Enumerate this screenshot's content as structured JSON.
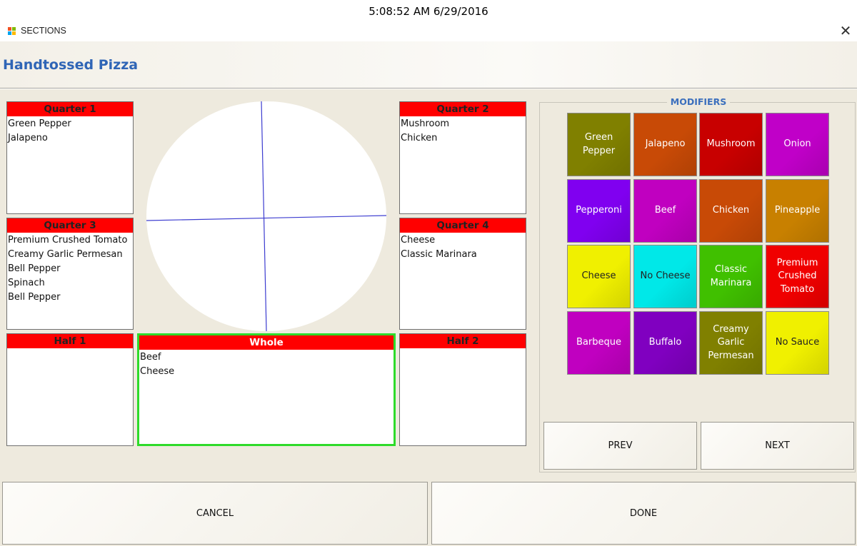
{
  "clock": "5:08:52 AM 6/29/2016",
  "window": {
    "title": "SECTIONS",
    "close_glyph": "✕"
  },
  "header": {
    "title": "Handtossed Pizza"
  },
  "sections": {
    "quarter1": {
      "title": "Quarter 1",
      "items": [
        "Green Pepper",
        "Jalapeno"
      ]
    },
    "quarter2": {
      "title": "Quarter 2",
      "items": [
        "Mushroom",
        "Chicken"
      ]
    },
    "quarter3": {
      "title": "Quarter 3",
      "items": [
        "Premium Crushed Tomato",
        "Creamy Garlic Permesan",
        "Bell Pepper",
        "Spinach",
        "Bell Pepper"
      ]
    },
    "quarter4": {
      "title": "Quarter 4",
      "items": [
        "Cheese",
        "Classic Marinara"
      ]
    },
    "half1": {
      "title": "Half 1",
      "items": []
    },
    "whole": {
      "title": "Whole",
      "items": [
        "Beef",
        "Cheese"
      ]
    },
    "half2": {
      "title": "Half 2",
      "items": []
    }
  },
  "modifiers": {
    "title": "MODIFIERS",
    "items": [
      {
        "label": "Green Pepper",
        "color": "#808000"
      },
      {
        "label": "Jalapeno",
        "color": "#c84a06"
      },
      {
        "label": "Mushroom",
        "color": "#c80000"
      },
      {
        "label": "Onion",
        "color": "#c000c8"
      },
      {
        "label": "Pepperoni",
        "color": "#8000f0"
      },
      {
        "label": "Beef",
        "color": "#c000c0"
      },
      {
        "label": "Chicken",
        "color": "#c84a06"
      },
      {
        "label": "Pineapple",
        "color": "#c88000"
      },
      {
        "label": "Cheese",
        "color": "#f0f000"
      },
      {
        "label": "No Cheese",
        "color": "#00e8e8"
      },
      {
        "label": "Classic Marinara",
        "color": "#40c000"
      },
      {
        "label": "Premium Crushed Tomato",
        "color": "#f00000"
      },
      {
        "label": "Barbeque",
        "color": "#c000c0"
      },
      {
        "label": "Buffalo",
        "color": "#8000c0"
      },
      {
        "label": "Creamy Garlic Permesan",
        "color": "#808000"
      },
      {
        "label": "No Sauce",
        "color": "#f0f000"
      }
    ]
  },
  "buttons": {
    "prev": "PREV",
    "next": "NEXT",
    "cancel": "CANCEL",
    "done": "DONE"
  },
  "colors": {
    "section_header": "#ff0000",
    "selected_border": "#2edb2a",
    "title_blue": "#2f65b6",
    "background": "#eeeade"
  }
}
